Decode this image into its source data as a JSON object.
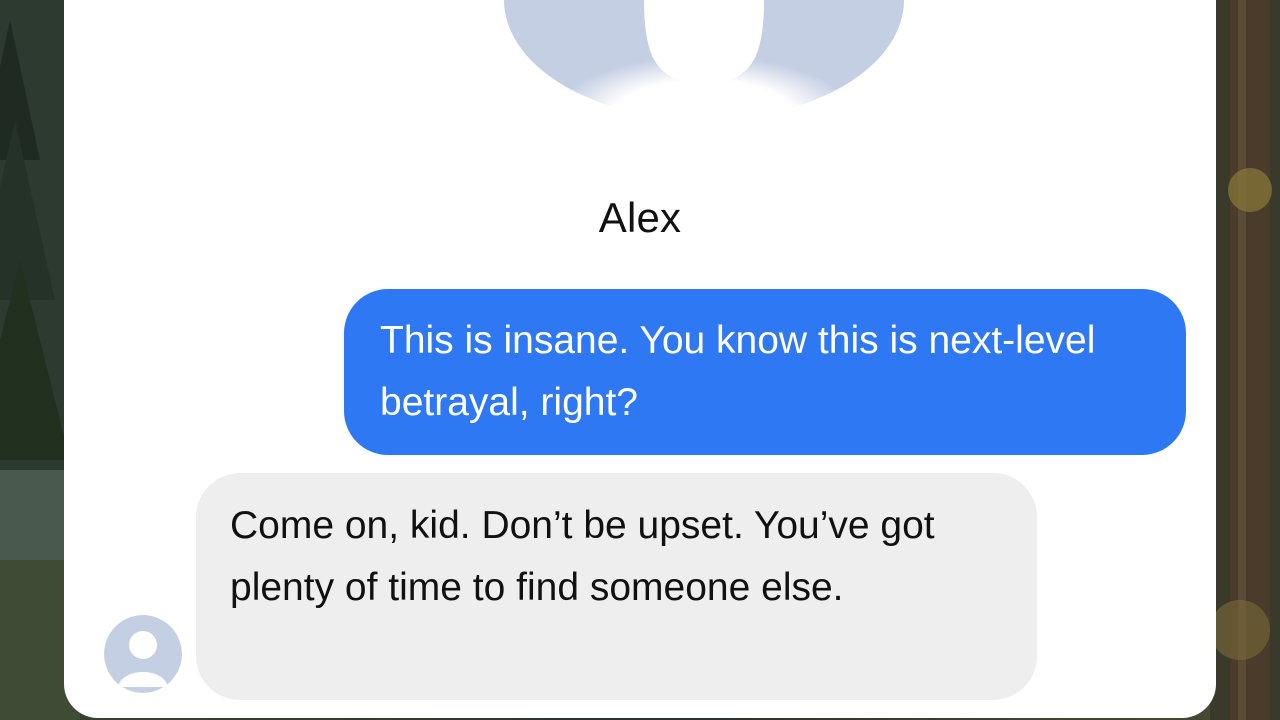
{
  "conversation": {
    "contact_name": "Alex",
    "messages": [
      {
        "sender": "me",
        "text": "This is insane. You know this is next-level betrayal, right?"
      },
      {
        "sender": "contact",
        "text": "Come on, kid. Don’t be upset. You’ve got plenty of time to find someone else."
      }
    ]
  },
  "colors": {
    "sent_bubble": "#2f78f3",
    "received_bubble": "#eeeeee",
    "avatar_placeholder": "#c5cfe4"
  },
  "icons": {
    "contact_avatar": "person-silhouette-icon",
    "message_avatar": "person-silhouette-icon"
  }
}
